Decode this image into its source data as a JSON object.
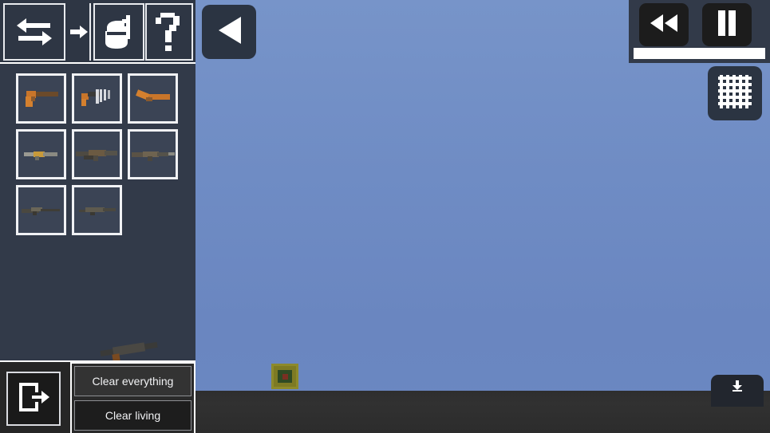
{
  "app": {
    "title": "Weapon Spawn Menu",
    "colors": {
      "panel": "#323a49",
      "panel_dark": "#2e3644",
      "sky_top": "#7794c9",
      "sky_bottom": "#6b88c2",
      "ground": "#2e2e2e",
      "accent_white": "#ffffff",
      "button_dark": "#1c1c1c",
      "crate_body": "#7d7a24",
      "crate_inner": "#2f4a24",
      "crate_dot": "#7a2f22"
    }
  },
  "toolbar": {
    "items": [
      {
        "name": "swap-arrows-icon",
        "label": "Swap"
      },
      {
        "name": "arrow-right-icon",
        "label": "Next"
      },
      {
        "name": "grenade-icon",
        "label": "Grenade"
      },
      {
        "name": "question-mark-icon",
        "label": "Help"
      }
    ]
  },
  "weapons": {
    "rows": [
      [
        {
          "name": "pistol",
          "label": "Pistol"
        },
        {
          "name": "submachine-gun",
          "label": "Submachine Gun"
        },
        {
          "name": "sawed-off-shotgun",
          "label": "Sawed-off Shotgun"
        }
      ],
      [
        {
          "name": "compact-rifle",
          "label": "Compact Rifle"
        },
        {
          "name": "assault-rifle",
          "label": "Assault Rifle"
        },
        {
          "name": "carbine-rifle",
          "label": "Carbine Rifle"
        }
      ],
      [
        {
          "name": "sniper-rifle",
          "label": "Sniper Rifle"
        },
        {
          "name": "marksman-rifle",
          "label": "Marksman Rifle"
        }
      ]
    ]
  },
  "bottom_bar": {
    "exit_icon": "exit-door-icon",
    "exit_label": "Exit",
    "clear_everything_label": "Clear everything",
    "clear_living_label": "Clear living"
  },
  "back_button": {
    "icon": "triangle-left-icon",
    "label": "Back"
  },
  "hud": {
    "rewind": {
      "icon": "rewind-icon",
      "label": "Rewind"
    },
    "pause": {
      "icon": "pause-icon",
      "label": "Pause"
    },
    "progress": {
      "value": 100,
      "label": "100%"
    }
  },
  "grid_button": {
    "icon": "grid-icon",
    "label": "Grid"
  },
  "corner_button": {
    "icon": "download-icon",
    "label": "Drop"
  },
  "scene": {
    "crate_label": "Ammo crate",
    "dragged_weapon_label": "Held weapon"
  }
}
